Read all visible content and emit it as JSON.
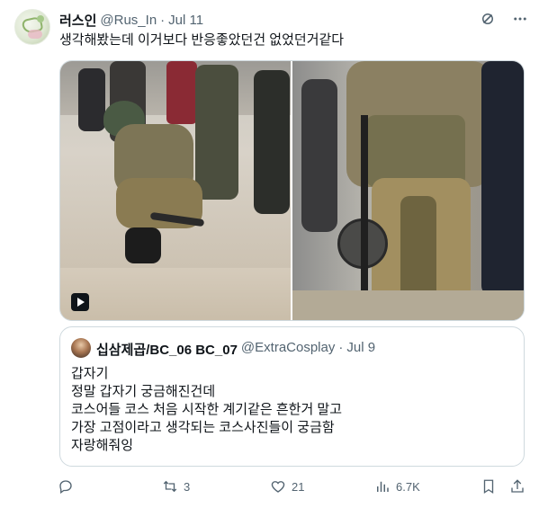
{
  "author": {
    "display_name": "러스인",
    "handle": "@Rus_In",
    "separator": "·",
    "date": "Jul 11",
    "avatar_icon": "avatar-image"
  },
  "tweet": {
    "text": "생각해봤는데 이거보다 반응좋았던건 없었던거같다"
  },
  "media": {
    "left_photo": "cosplay-photo-crouching",
    "right_photo": "cosplay-photo-standing",
    "video_indicator_icon": "play-icon"
  },
  "quoted": {
    "display_name": "십삼제곱/BC_06 BC_07",
    "handle": "@ExtraCosplay",
    "separator": "·",
    "date": "Jul 9",
    "lines": [
      "갑자기",
      "정말 갑자기 궁금해진건데",
      "코스어들 코스 처음 시작한 계기같은 흔한거 말고",
      "가장 고점이라고 생각되는 코스사진들이 궁금함",
      "자랑해줘잉"
    ]
  },
  "actions": {
    "reply_count": "",
    "retweet_count": "3",
    "like_count": "21",
    "views_count": "6.7K"
  },
  "icons": {
    "grok": "grok-icon",
    "more": "more-icon",
    "reply": "reply-icon",
    "retweet": "retweet-icon",
    "like": "heart-icon",
    "views": "views-icon",
    "bookmark": "bookmark-icon",
    "share": "share-icon"
  },
  "colors": {
    "text_primary": "#0f1419",
    "text_secondary": "#536471",
    "border": "#cfd9de"
  }
}
